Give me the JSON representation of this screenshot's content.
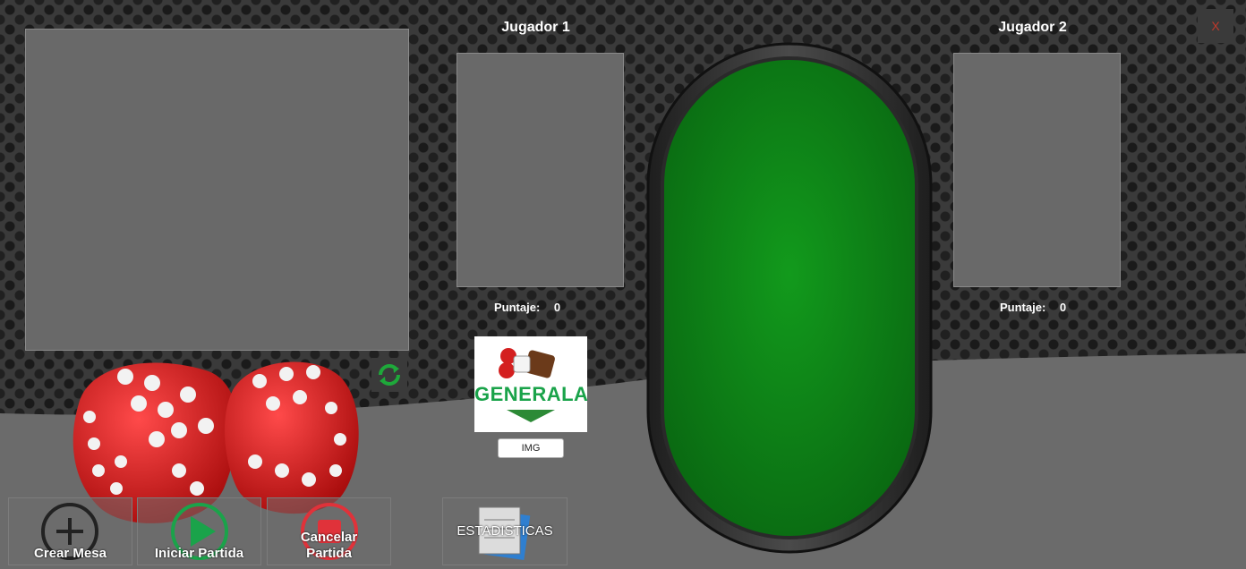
{
  "window": {
    "close_label": "X"
  },
  "players": [
    {
      "title": "Jugador 1",
      "score_label": "Puntaje:",
      "score": "0"
    },
    {
      "title": "Jugador 2",
      "score_label": "Puntaje:",
      "score": "0"
    }
  ],
  "logo": {
    "text": "GENERALA",
    "button_label": "IMG"
  },
  "actions": {
    "create_table": "Crear Mesa",
    "start_game": "Iniciar Partida",
    "cancel_game_line1": "Cancelar",
    "cancel_game_line2": "Partida",
    "statistics": "ESTADISTICAS"
  },
  "colors": {
    "table_felt": "#0f8a18",
    "start_icon": "#1aa34a",
    "cancel_icon": "#e0323a",
    "refresh_icon": "#1ea83a",
    "logo_green": "#1aa34a"
  },
  "icons": {
    "create_table": "plus-circle-icon",
    "start_game": "play-circle-icon",
    "cancel_game": "stop-circle-icon",
    "statistics": "clipboard-icon",
    "refresh": "refresh-icon",
    "dice": "red-dice-icon"
  }
}
